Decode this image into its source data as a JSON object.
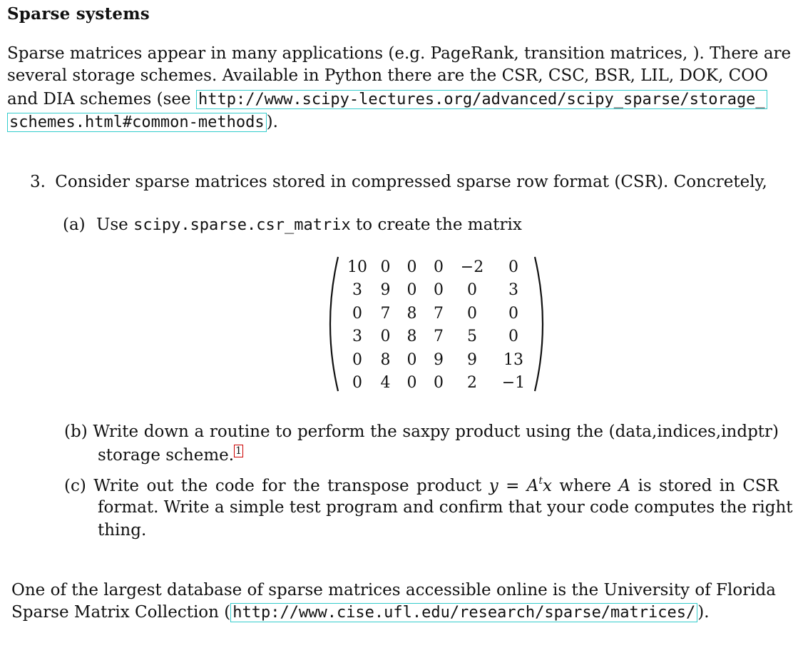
{
  "section_title": "Sparse systems",
  "intro": {
    "line1": "Sparse matrices appear in many applications (e.g. PageRank, transition matrices, ). There are",
    "line2": "several storage schemes. Available in Python there are the CSR, CSC, BSR, LIL, DOK, COO",
    "line3_prefix": "and DIA schemes (see ",
    "link_part1": "http://www.scipy-lectures.org/advanced/scipy_sparse/storage_",
    "link_part2": "schemes.html#common-methods",
    "line4_suffix": ")."
  },
  "problem": {
    "number": "3.",
    "text": "Consider sparse matrices stored in compressed sparse row format (CSR). Concretely,"
  },
  "part_a": {
    "label": "(a)",
    "prefix": "Use ",
    "code": "scipy.sparse.csr_matrix",
    "suffix": " to create the matrix"
  },
  "matrix": [
    [
      "10",
      "0",
      "0",
      "0",
      "−2",
      "0"
    ],
    [
      "3",
      "9",
      "0",
      "0",
      "0",
      "3"
    ],
    [
      "0",
      "7",
      "8",
      "7",
      "0",
      "0"
    ],
    [
      "3",
      "0",
      "8",
      "7",
      "5",
      "0"
    ],
    [
      "0",
      "8",
      "0",
      "9",
      "9",
      "13"
    ],
    [
      "0",
      "4",
      "0",
      "0",
      "2",
      "−1"
    ]
  ],
  "part_b": {
    "label": "(b)",
    "line1": "Write down a routine to perform the saxpy product using the (data,indices,indptr)",
    "line2": "storage scheme.",
    "footnote": "1"
  },
  "part_c": {
    "label": "(c)",
    "line1_prefix": "Write out the code for the transpose product ",
    "var_y": "y",
    "equals": " = ",
    "var_A": "A",
    "sup_t": "t",
    "var_x": "x",
    "line1_mid": " where ",
    "var_A2": "A",
    "line1_suffix": " is stored in CSR",
    "line2": "format. Write a simple test program and confirm that your code computes the right",
    "line3": "thing."
  },
  "closing": {
    "line1": "One of the largest database of sparse matrices accessible online is the University of Florida",
    "line2_prefix": "Sparse Matrix Collection (",
    "link": "http://www.cise.ufl.edu/research/sparse/matrices/",
    "line2_suffix": ")."
  }
}
